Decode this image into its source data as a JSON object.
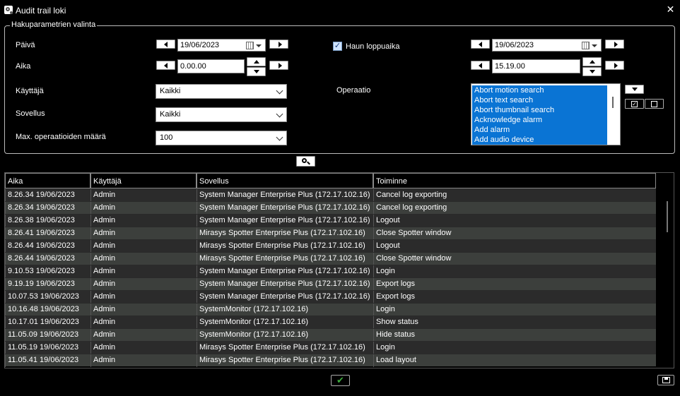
{
  "window": {
    "title": "Audit trail loki",
    "close_label": "✕"
  },
  "search": {
    "group_title": "Hakuparametrien valinta",
    "date_label": "Päivä",
    "time_label": "Aika",
    "user_label": "Käyttäjä",
    "application_label": "Sovellus",
    "max_ops_label": "Max. operaatioiden määrä",
    "start_date": "19/06/2023",
    "start_time": "0.00.00",
    "end_enabled_label": "Haun loppuaika",
    "end_enabled": true,
    "end_date": "19/06/2023",
    "end_time": "15.19.00",
    "user_value": "Kaikki",
    "application_value": "Kaikki",
    "max_ops_value": "100",
    "operation_label": "Operaatio",
    "operations": [
      "Abort motion search",
      "Abort text search",
      "Abort thumbnail search",
      "Acknowledge alarm",
      "Add alarm",
      "Add audio device"
    ]
  },
  "table": {
    "columns": [
      "Aika",
      "Käyttäjä",
      "Sovellus",
      "Toiminne"
    ],
    "rows": [
      [
        "8.26.34 19/06/2023",
        "Admin",
        "System Manager Enterprise Plus (172.17.102.16)",
        "Cancel log exporting"
      ],
      [
        "8.26.34 19/06/2023",
        "Admin",
        "System Manager Enterprise Plus (172.17.102.16)",
        "Cancel log exporting"
      ],
      [
        "8.26.38 19/06/2023",
        "Admin",
        "System Manager Enterprise Plus (172.17.102.16)",
        "Logout"
      ],
      [
        "8.26.41 19/06/2023",
        "Admin",
        "Mirasys Spotter Enterprise Plus (172.17.102.16)",
        "Close Spotter window"
      ],
      [
        "8.26.44 19/06/2023",
        "Admin",
        "Mirasys Spotter Enterprise Plus (172.17.102.16)",
        "Logout"
      ],
      [
        "8.26.44 19/06/2023",
        "Admin",
        "Mirasys Spotter Enterprise Plus (172.17.102.16)",
        "Close Spotter window"
      ],
      [
        "9.10.53 19/06/2023",
        "Admin",
        "System Manager Enterprise Plus (172.17.102.16)",
        "Login"
      ],
      [
        "9.19.19 19/06/2023",
        "Admin",
        "System Manager Enterprise Plus (172.17.102.16)",
        "Export logs"
      ],
      [
        "10.07.53 19/06/2023",
        "Admin",
        "System Manager Enterprise Plus (172.17.102.16)",
        "Export logs"
      ],
      [
        "10.16.48 19/06/2023",
        "Admin",
        "SystemMonitor (172.17.102.16)",
        "Login"
      ],
      [
        "10.17.01 19/06/2023",
        "Admin",
        "SystemMonitor (172.17.102.16)",
        "Show status"
      ],
      [
        "11.05.09 19/06/2023",
        "Admin",
        "SystemMonitor (172.17.102.16)",
        "Hide status"
      ],
      [
        "11.05.19 19/06/2023",
        "Admin",
        "Mirasys Spotter Enterprise Plus (172.17.102.16)",
        "Login"
      ],
      [
        "11.05.41 19/06/2023",
        "Admin",
        "Mirasys Spotter Enterprise Plus (172.17.102.16)",
        "Load layout"
      ]
    ]
  },
  "colors": {
    "selection": "#0a74d4",
    "row_even": "#2b2b2b",
    "row_odd": "#3c3f3c",
    "ok": "#3fae3f"
  },
  "icons": {
    "app": "gear-icon",
    "close": "close-icon",
    "search": "magnifier-icon",
    "ok": "checkmark-icon",
    "save": "floppy-disk-icon",
    "calendar": "calendar-icon"
  }
}
